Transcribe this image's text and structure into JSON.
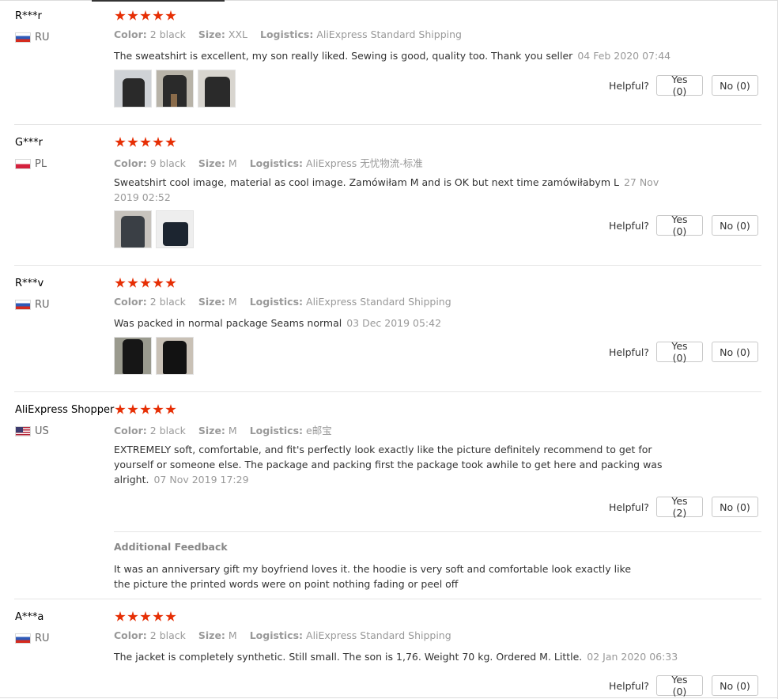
{
  "labels": {
    "color": "Color:",
    "size": "Size:",
    "logistics": "Logistics:",
    "helpful": "Helpful?"
  },
  "colors": {
    "star": "#e62e04",
    "meta": "#999999",
    "border": "#c8c8c8"
  },
  "reviews": [
    {
      "user": "R***r",
      "country": "RU",
      "flag": "ru",
      "stars": 5,
      "color": "2 black",
      "size": "XXL",
      "logistics": "AliExpress Standard Shipping",
      "text": "The sweatshirt is excellent, my son really liked. Sewing is good, quality too. Thank you seller",
      "date": "04 Feb 2020 07:44",
      "photos": 3,
      "yes": "Yes (0)",
      "no": "No (0)"
    },
    {
      "user": "G***r",
      "country": "PL",
      "flag": "pl",
      "stars": 5,
      "color": "9 black",
      "size": "M",
      "logistics": "AliExpress 无忧物流-标准",
      "text": "Sweatshirt cool image, material as cool image. Zamówiłam M and is OK but next time zamówiłabym L",
      "date": "27 Nov 2019 02:52",
      "photos": 2,
      "yes": "Yes (0)",
      "no": "No (0)"
    },
    {
      "user": "R***v",
      "country": "RU",
      "flag": "ru",
      "stars": 5,
      "color": "2 black",
      "size": "M",
      "logistics": "AliExpress Standard Shipping",
      "text": "Was packed in normal package Seams normal",
      "date": "03 Dec 2019 05:42",
      "photos": 2,
      "yes": "Yes (0)",
      "no": "No (0)"
    },
    {
      "user": "AliExpress Shopper",
      "country": "US",
      "flag": "us",
      "stars": 5,
      "color": "2 black",
      "size": "M",
      "logistics": "e邮宝",
      "text": "EXTREMELY soft, comfortable, and fit's perfectly look exactly like the picture definitely recommend to get for yourself or someone else. The package and packing first the package took awhile to get here and packing was alright.",
      "date": "07 Nov 2019 17:29",
      "photos": 0,
      "yes": "Yes (2)",
      "no": "No (0)",
      "additional_title": "Additional Feedback",
      "additional_text": "It was an anniversary gift my boyfriend loves it. the hoodie is very soft and comfortable look exactly like the picture the printed words were on point nothing fading or peel off"
    },
    {
      "user": "A***a",
      "country": "RU",
      "flag": "ru",
      "stars": 5,
      "color": "2 black",
      "size": "M",
      "logistics": "AliExpress Standard Shipping",
      "text": "The jacket is completely synthetic. Still small. The son is 1,76. Weight 70 kg. Ordered M. Little.",
      "date": "02 Jan 2020 06:33",
      "photos": 0,
      "yes": "Yes (0)",
      "no": "No (0)"
    }
  ]
}
